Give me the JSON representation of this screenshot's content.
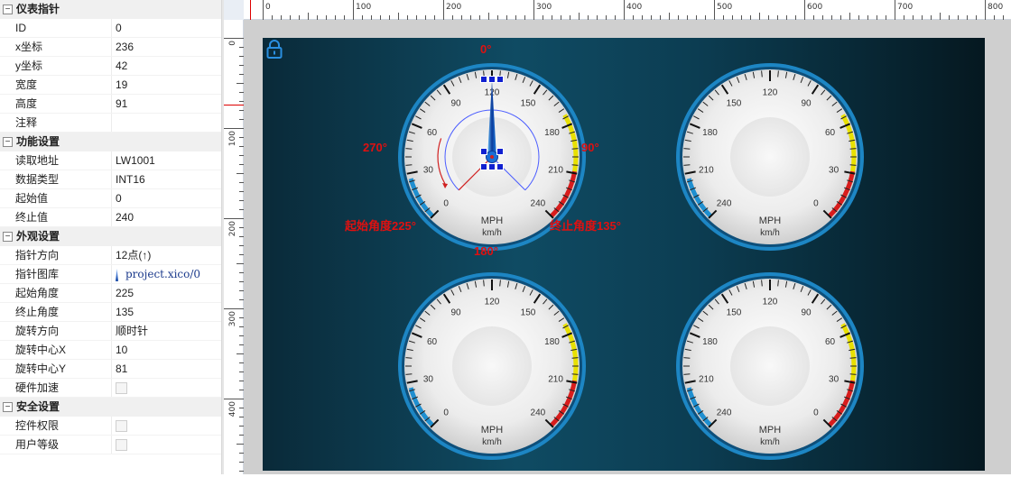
{
  "panel": {
    "categories": [
      {
        "name": "仪表指针",
        "toggle": "⊟",
        "rows": [
          {
            "key": "ID",
            "value": "0"
          },
          {
            "key": "x坐标",
            "value": "236"
          },
          {
            "key": "y坐标",
            "value": "42"
          },
          {
            "key": "宽度",
            "value": "19"
          },
          {
            "key": "高度",
            "value": "91"
          },
          {
            "key": "注释",
            "value": ""
          }
        ]
      },
      {
        "name": "功能设置",
        "toggle": "⊟",
        "rows": [
          {
            "key": "读取地址",
            "value": "LW1001"
          },
          {
            "key": "数据类型",
            "value": "INT16"
          },
          {
            "key": "起始值",
            "value": "0"
          },
          {
            "key": "终止值",
            "value": "240"
          }
        ]
      },
      {
        "name": "外观设置",
        "toggle": "⊟",
        "rows": [
          {
            "key": "指针方向",
            "value": "12点(↑)"
          },
          {
            "key": "指针图库",
            "value": "project.xico/0"
          },
          {
            "key": "起始角度",
            "value": "225"
          },
          {
            "key": "终止角度",
            "value": "135"
          },
          {
            "key": "旋转方向",
            "value": "顺时针"
          },
          {
            "key": "旋转中心X",
            "value": "10"
          },
          {
            "key": "旋转中心Y",
            "value": "81"
          },
          {
            "key": "硬件加速",
            "value": ""
          }
        ]
      },
      {
        "name": "安全设置",
        "toggle": "⊟",
        "rows": [
          {
            "key": "控件权限",
            "value": ""
          },
          {
            "key": "用户等级",
            "value": ""
          }
        ]
      }
    ]
  },
  "ruler": {
    "top_labels": [
      "0",
      "100",
      "200",
      "300",
      "400",
      "500",
      "600",
      "700",
      "800"
    ],
    "left_labels": [
      "0",
      "100",
      "200",
      "300",
      "400"
    ]
  },
  "gauge_texts": {
    "unit1": "MPH",
    "unit2": "km/h",
    "cw_ticks": [
      "0",
      "30",
      "60",
      "90",
      "120",
      "150",
      "180",
      "210",
      "240"
    ],
    "ccw_ticks": [
      "240",
      "210",
      "180",
      "150",
      "120",
      "90",
      "60",
      "30",
      "0"
    ]
  },
  "annotations": {
    "top": "0°",
    "left": "270°",
    "right": "90°",
    "bottom": "180°",
    "start": "起始角度225°",
    "end": "终止角度135°"
  },
  "colors": {
    "annotation": "#e01010",
    "gauge_ring": "#1f8fd0",
    "arc_yellow": "#e8e000",
    "arc_red": "#d81c1c",
    "needle": "#1b5fd0"
  },
  "icons": {
    "lock": "lock-icon",
    "needle_lib": "needle-icon",
    "collapse": "collapse-icon"
  }
}
